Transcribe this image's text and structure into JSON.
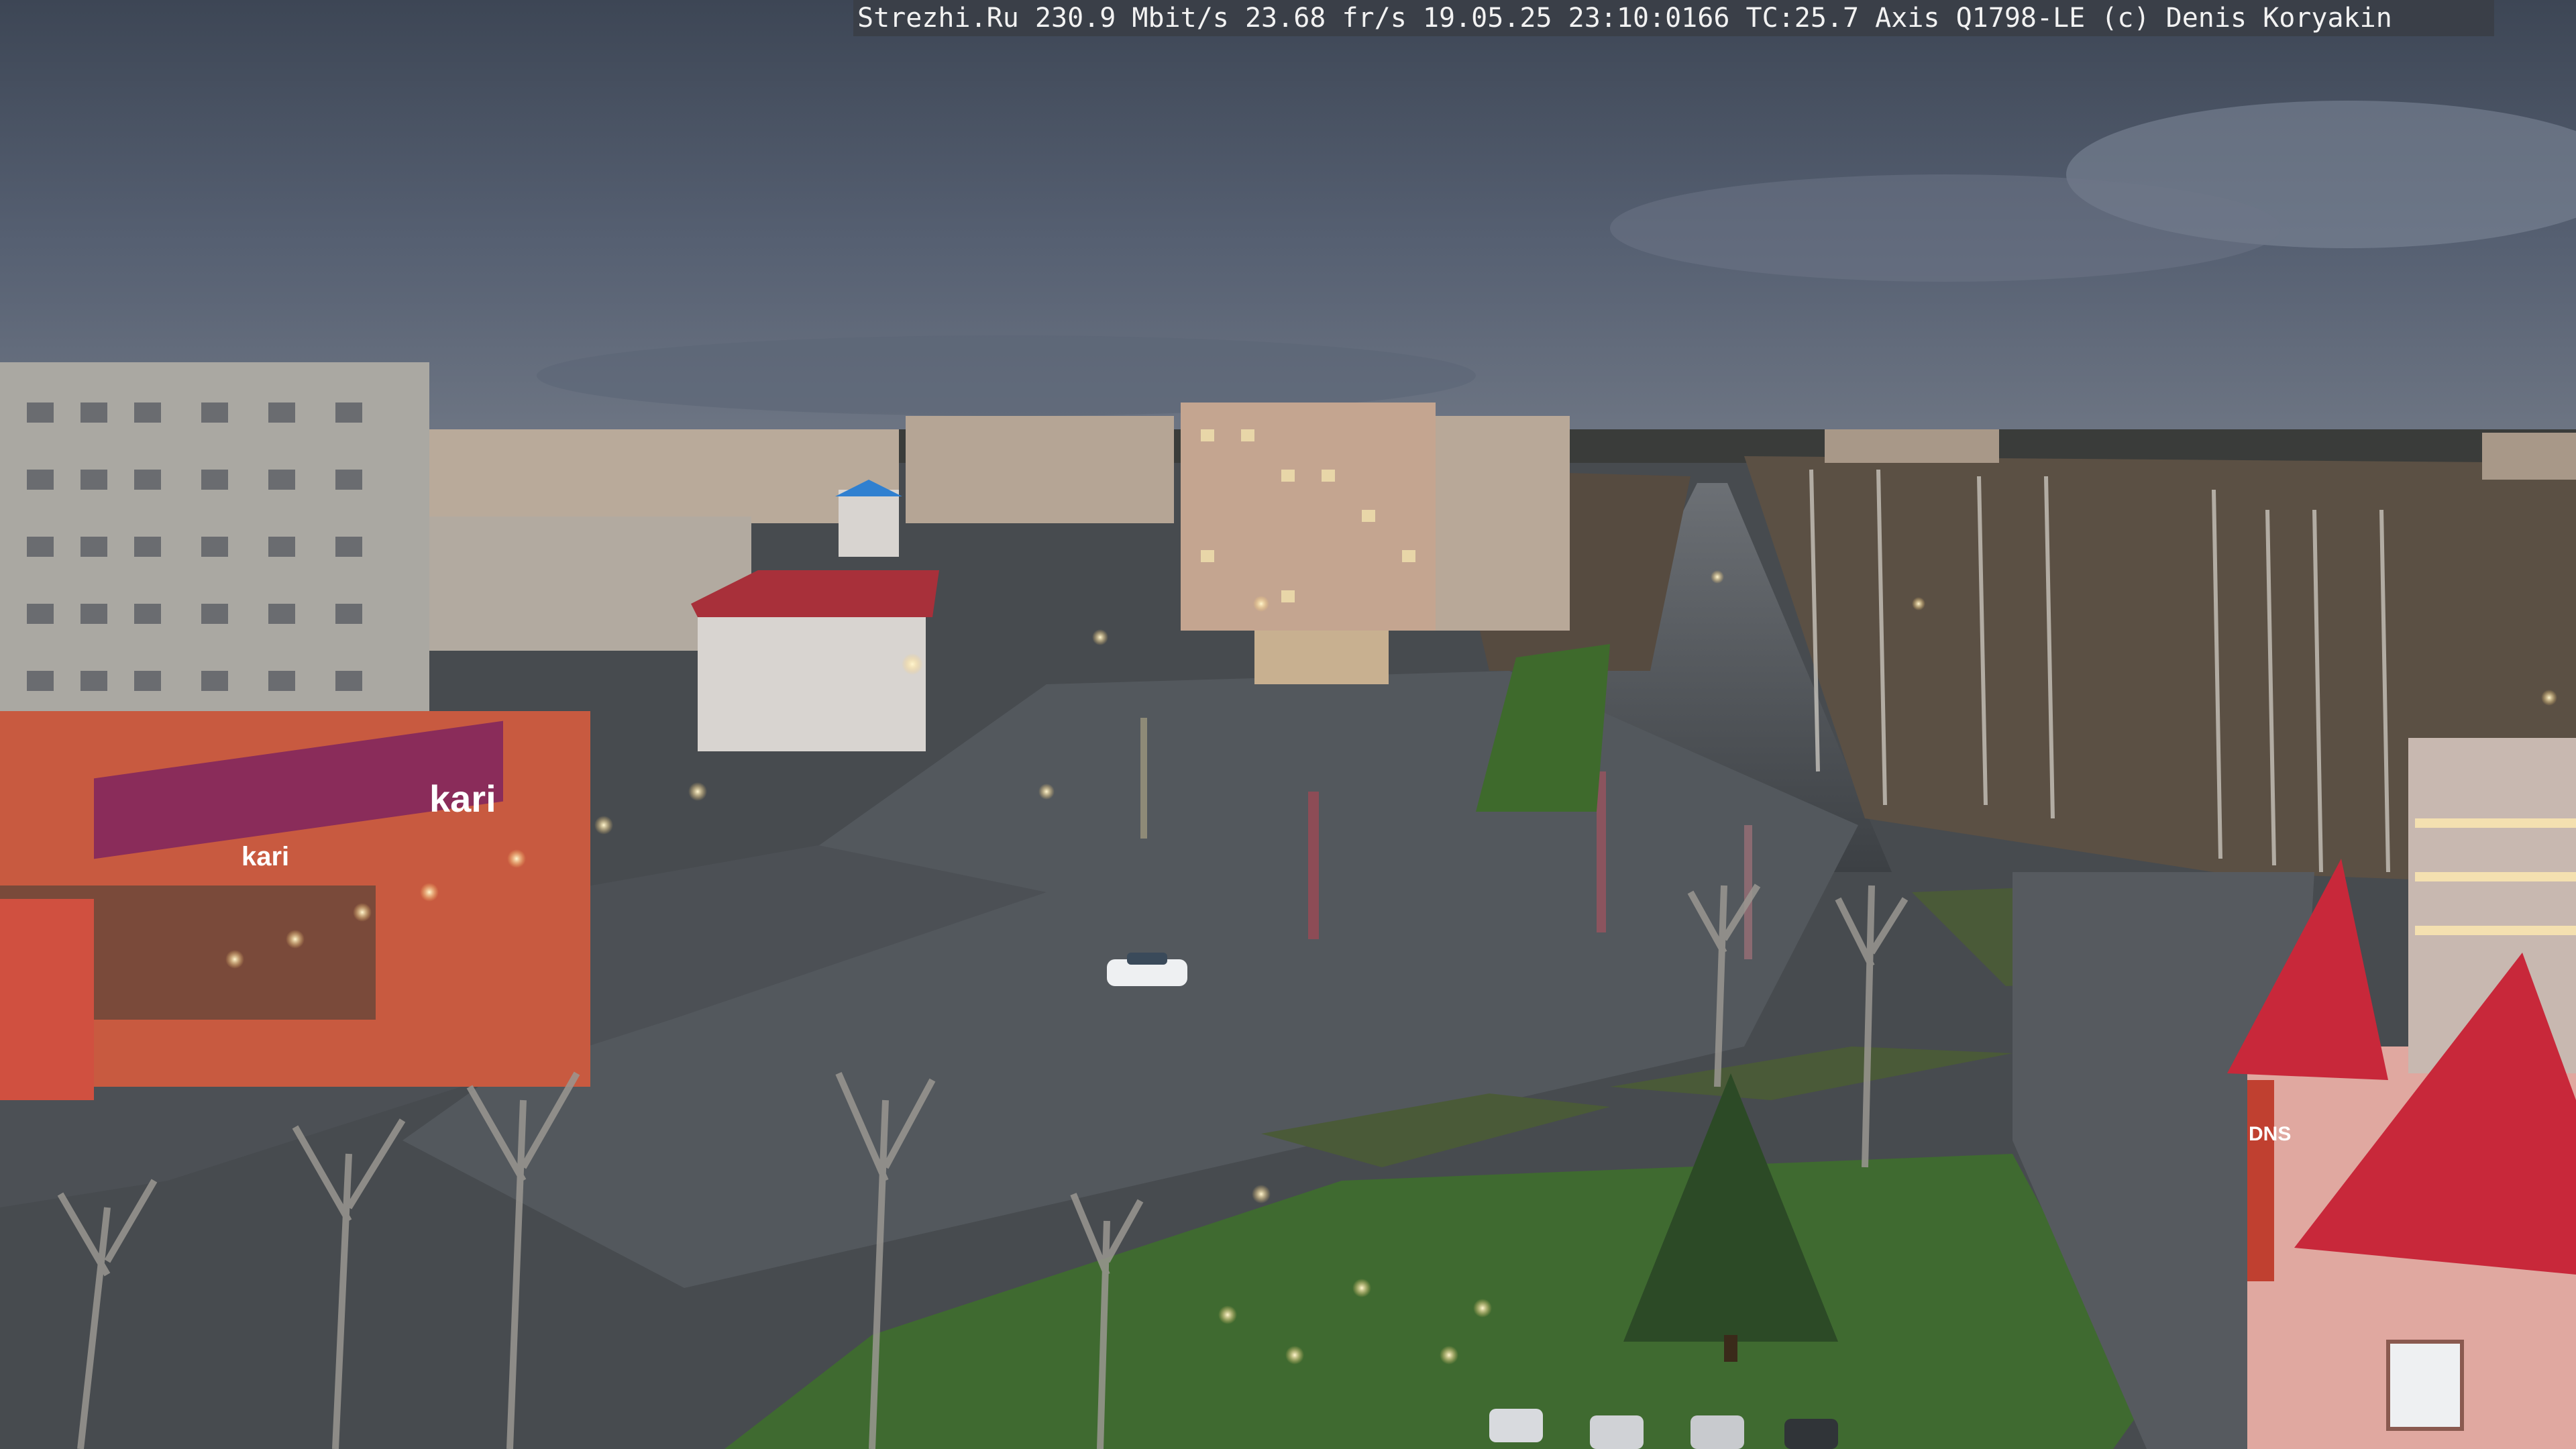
{
  "camera_overlay": {
    "text": "Strezhi.Ru 230.9 Mbit/s 23.68 fr/s 19.05.25 23:10:0166 TC:25.7  Axis Q1798-LE  (c) Denis Koryakin"
  },
  "signs": {
    "store_left": "kari",
    "store_left_small": "kari",
    "store_right_vertical": "DNS"
  },
  "colors": {
    "sky": "#4a5566",
    "roofs_red": "#c8283a",
    "asphalt": "#4e5358",
    "grass": "#3f6a30"
  }
}
